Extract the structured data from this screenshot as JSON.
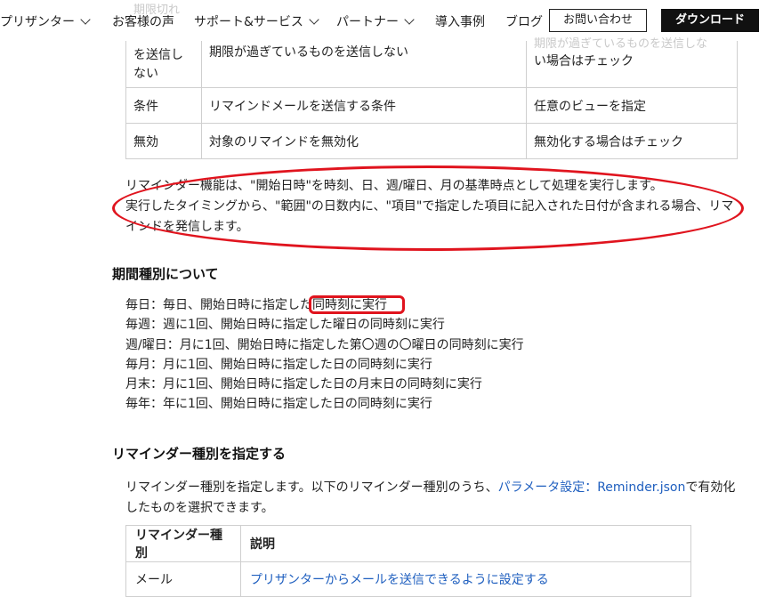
{
  "nav": {
    "items": [
      {
        "label": "プリザンター",
        "has_dropdown": true
      },
      {
        "label": "お客様の声",
        "has_dropdown": false
      },
      {
        "label": "サポート&サービス",
        "has_dropdown": true
      },
      {
        "label": "パートナー",
        "has_dropdown": true
      },
      {
        "label": "導入事例",
        "has_dropdown": false
      },
      {
        "label": "ブログ",
        "has_dropdown": false
      }
    ],
    "contact_label": "お問い合わせ",
    "download_label": "ダウンロード"
  },
  "behind_nav": {
    "left_fragment": "期限切れ",
    "right_fragment": "期限が過ぎているものを送信しな"
  },
  "settings_table": {
    "rows": [
      {
        "name_lines": [
          "を送信し",
          "ない"
        ],
        "desc": "期限が過ぎているものを送信しない",
        "note": "い場合はチェック"
      },
      {
        "name": "条件",
        "desc": "リマインドメールを送信する条件",
        "note": "任意のビューを指定"
      },
      {
        "name": "無効",
        "desc": "対象のリマインドを無効化",
        "note": "無効化する場合はチェック"
      }
    ]
  },
  "callout": {
    "line1": "リマインダー機能は、\"開始日時\"を時刻、日、週/曜日、月の基準時点として処理を実行します。",
    "line2": "実行したタイミングから、\"範囲\"の日数内に、\"項目\"で指定した項目に記入された日付が含まれる場合、リマ",
    "line3": "インドを発信します。",
    "highlight_color": "#e0141e"
  },
  "period_section": {
    "heading": "期間種別について",
    "items": [
      {
        "pre": "毎日：毎日、開始日時に指定した",
        "highlight": "同時刻に実行"
      },
      {
        "text": "毎週：週に1回、開始日時に指定した曜日の同時刻に実行"
      },
      {
        "text": "週/曜日：月に1回、開始日時に指定した第〇週の〇曜日の同時刻に実行"
      },
      {
        "text": "毎月：月に1回、開始日時に指定した日の同時刻に実行"
      },
      {
        "text": "月末：月に1回、開始日時に指定した日の月末日の同時刻に実行"
      },
      {
        "text": "毎年：年に1回、開始日時に指定した日の同時刻に実行"
      }
    ]
  },
  "type_section": {
    "heading": "リマインダー種別を指定する",
    "desc_pre": "リマインダー種別を指定します。以下のリマインダー種別のうち、",
    "desc_link": "パラメータ設定：Reminder.json",
    "desc_mid": "で有効化",
    "desc_post": "したものを選択できます。",
    "table": {
      "headers": [
        "リマインダー種別",
        "説明"
      ],
      "rows": [
        {
          "type": "メール",
          "desc": "プリザンターからメールを送信できるように設定する"
        }
      ]
    },
    "link_color": "#1f5fbf"
  }
}
